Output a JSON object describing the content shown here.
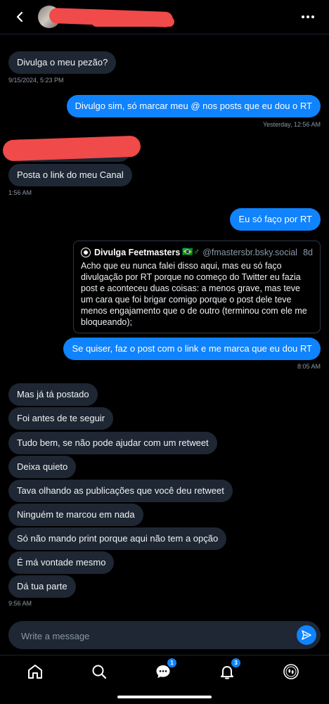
{
  "header": {
    "back_icon": "chevron-left-icon",
    "more_icon": "more-horizontal-icon"
  },
  "messages": [
    {
      "id": "m1",
      "direction": "incoming",
      "text": "Divulga o meu pezão?"
    },
    {
      "id": "t1",
      "timestamp": "9/15/2024, 5:23 PM"
    },
    {
      "id": "m2",
      "direction": "outgoing",
      "text": "Divulgo sim, só marcar meu @ nos posts que eu dou o RT"
    },
    {
      "id": "t2",
      "timestamp": "Yesterday, 12:56 AM"
    },
    {
      "id": "m3",
      "direction": "incoming",
      "text": "Posta o link do meu Canal"
    },
    {
      "id": "t3",
      "timestamp": "1:56 AM"
    },
    {
      "id": "m4",
      "direction": "outgoing",
      "text": "Eu só faço por RT"
    },
    {
      "id": "m5",
      "direction": "outgoing",
      "text": "Se quiser, faz o post com o link e me marca que eu dou RT"
    },
    {
      "id": "t4",
      "timestamp": "8:05 AM"
    },
    {
      "id": "m6",
      "direction": "incoming",
      "text": "Mas já tá postado"
    },
    {
      "id": "m7",
      "direction": "incoming",
      "text": "Foi antes de te seguir"
    },
    {
      "id": "m8",
      "direction": "incoming",
      "text": "Tudo bem, se não pode ajudar com um retweet"
    },
    {
      "id": "m9",
      "direction": "incoming",
      "text": "Deixa quieto"
    },
    {
      "id": "m10",
      "direction": "incoming",
      "text": "Tava olhando as publicações que você deu retweet"
    },
    {
      "id": "m11",
      "direction": "incoming",
      "text": "Ninguém te marcou em nada"
    },
    {
      "id": "m12",
      "direction": "incoming",
      "text": "Só não mando print porque aqui não tem a opção"
    },
    {
      "id": "m13",
      "direction": "incoming",
      "text": "É má vontade mesmo"
    },
    {
      "id": "m14",
      "direction": "incoming",
      "text": "Dá tua parte"
    },
    {
      "id": "t5",
      "timestamp": "9:56 AM"
    }
  ],
  "quote": {
    "author": "Divulga Feetmasters",
    "emoji": "🇧🇷♂",
    "handle": "@fmastersbr.bsky.social",
    "age": "8d",
    "text": "Acho que eu nunca falei disso aqui, mas eu só faço divulgação por RT porque no começo do Twitter eu fazia post e aconteceu duas coisas: a menos grave, mas teve um cara que foi brigar comigo porque o post dele teve menos engajamento que o de outro (terminou com ele me bloqueando);"
  },
  "composer": {
    "placeholder": "Write a message",
    "send_icon": "send-icon"
  },
  "tabbar": {
    "items": [
      {
        "name": "home",
        "icon": "home-icon"
      },
      {
        "name": "search",
        "icon": "search-icon"
      },
      {
        "name": "chat",
        "icon": "chat-icon",
        "badge": "1"
      },
      {
        "name": "notifications",
        "icon": "bell-icon",
        "badge": "3"
      },
      {
        "name": "profile",
        "icon": "avatar-icon"
      }
    ]
  },
  "colors": {
    "background": "#000000",
    "incoming_bubble": "#1e2733",
    "outgoing_bubble": "#1083fe",
    "muted_text": "#8b98a5",
    "redaction": "#f04a4a"
  }
}
